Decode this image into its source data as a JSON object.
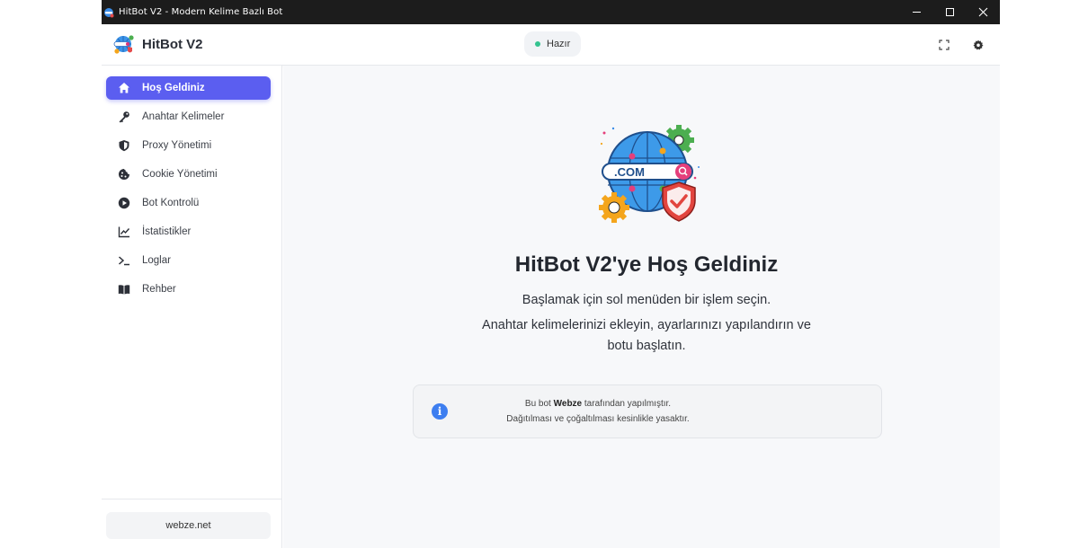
{
  "window": {
    "title": "HitBot V2 - Modern Kelime Bazlı Bot"
  },
  "header": {
    "brand_name": "HitBot V2",
    "status_label": "Hazır",
    "status_color": "#34c38f"
  },
  "sidebar": {
    "items": [
      {
        "label": "Hoş Geldiniz",
        "icon": "home-icon",
        "active": true
      },
      {
        "label": "Anahtar Kelimeler",
        "icon": "key-icon"
      },
      {
        "label": "Proxy Yönetimi",
        "icon": "shield-icon"
      },
      {
        "label": "Cookie Yönetimi",
        "icon": "cookie-icon"
      },
      {
        "label": "Bot Kontrolü",
        "icon": "play-circle-icon"
      },
      {
        "label": "İstatistikler",
        "icon": "chart-line-icon"
      },
      {
        "label": "Loglar",
        "icon": "terminal-icon"
      },
      {
        "label": "Rehber",
        "icon": "book-icon"
      }
    ],
    "footer_link": "webze.net"
  },
  "main": {
    "illustration_text": ".COM",
    "title": "HitBot V2'ye Hoş Geldiniz",
    "subtitle1": "Başlamak için sol menüden bir işlem seçin.",
    "subtitle2": "Anahtar kelimelerinizi ekleyin, ayarlarınızı yapılandırın ve botu başlatın.",
    "info": {
      "line1_prefix": "Bu bot",
      "line1_bold": "Webze",
      "line1_suffix": "tarafından yapılmıştır.",
      "line2": "Dağıtılması ve çoğaltılması kesinlikle yasaktır."
    }
  },
  "colors": {
    "accent": "#5b5ef0",
    "info": "#3d7ef0"
  }
}
